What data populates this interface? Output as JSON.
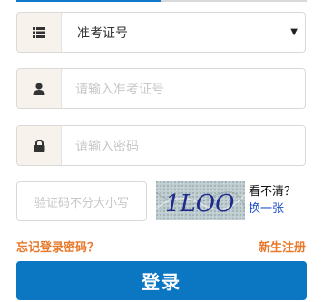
{
  "tabs": {
    "active_color": "#0d7ac9"
  },
  "id_type_select": {
    "icon": "list-icon",
    "selected_value": "准考证号"
  },
  "account_field": {
    "icon": "user-icon",
    "placeholder": "请输入准考证号"
  },
  "password_field": {
    "icon": "lock-icon",
    "placeholder": "请输入密码"
  },
  "captcha": {
    "placeholder": "验证码不分大小写",
    "image_text": "1LOO",
    "cant_see_label": "看不清？",
    "refresh_label": "换一张"
  },
  "links": {
    "forgot_password": "忘记登录密码？",
    "register": "新生注册"
  },
  "login_button": {
    "label": "登录",
    "color": "#0b77c3"
  }
}
